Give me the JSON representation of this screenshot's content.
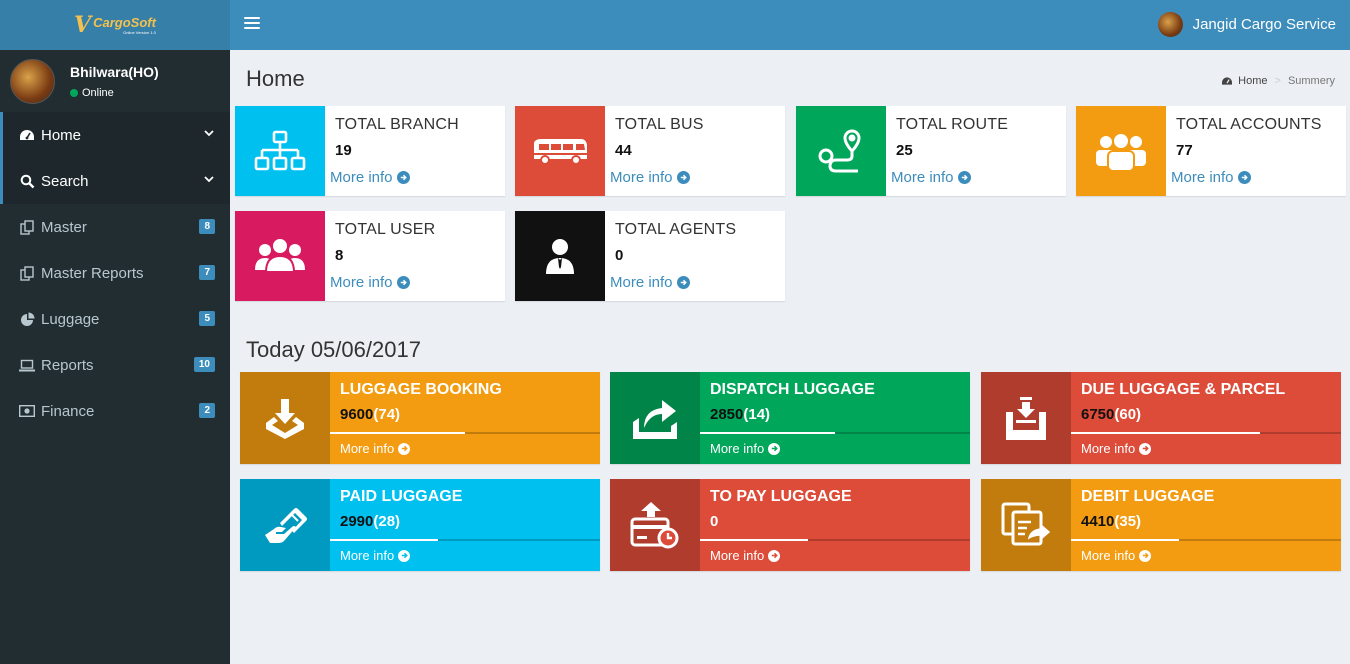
{
  "brand": {
    "name": "CargoSoft",
    "tagline": "Online Version 1.0"
  },
  "header": {
    "company": "Jangid Cargo Service"
  },
  "user": {
    "name": "Bhilwara(HO)",
    "status": "Online"
  },
  "menu": [
    {
      "label": "Home",
      "icon": "dashboard-icon",
      "active": true,
      "badge": ""
    },
    {
      "label": "Search",
      "icon": "search-icon",
      "active": true,
      "badge": ""
    },
    {
      "label": "Master",
      "icon": "copy-icon",
      "active": false,
      "badge": "8"
    },
    {
      "label": "Master Reports",
      "icon": "copy-icon",
      "active": false,
      "badge": "7"
    },
    {
      "label": "Luggage",
      "icon": "pie-chart-icon",
      "active": false,
      "badge": "5"
    },
    {
      "label": "Reports",
      "icon": "laptop-icon",
      "active": false,
      "badge": "10"
    },
    {
      "label": "Finance",
      "icon": "money-icon",
      "active": false,
      "badge": "2"
    }
  ],
  "page": {
    "title": "Home",
    "breadcrumb_home": "Home",
    "breadcrumb_current": "Summery"
  },
  "info_boxes": [
    {
      "label": "TOTAL BRANCH",
      "value": "19",
      "more": "More info",
      "color": "#00c0ef",
      "icon": "sitemap-icon"
    },
    {
      "label": "TOTAL BUS",
      "value": "44",
      "more": "More info",
      "color": "#dd4b39",
      "icon": "bus-icon"
    },
    {
      "label": "TOTAL ROUTE",
      "value": "25",
      "more": "More info",
      "color": "#00a65a",
      "icon": "route-icon"
    },
    {
      "label": "TOTAL ACCOUNTS",
      "value": "77",
      "more": "More info",
      "color": "#f39c12",
      "icon": "users-icon"
    },
    {
      "label": "TOTAL USER",
      "value": "8",
      "more": "More info",
      "color": "#d81b60",
      "icon": "group-icon"
    },
    {
      "label": "TOTAL AGENTS",
      "value": "0",
      "more": "More info",
      "color": "#111111",
      "icon": "agent-icon"
    }
  ],
  "today": {
    "label": "Today 05/06/2017"
  },
  "stat_boxes": [
    {
      "title": "LUGGAGE BOOKING",
      "amount": "9600",
      "count": "(74)",
      "progress": 0.5,
      "more": "More info",
      "color": "#f39c12",
      "icon": "download-tray-icon"
    },
    {
      "title": "DISPATCH LUGGAGE",
      "amount": "2850",
      "count": "(14)",
      "progress": 0.5,
      "more": "More info",
      "color": "#00a65a",
      "icon": "share-box-icon"
    },
    {
      "title": "DUE LUGGAGE & PARCEL",
      "amount": "6750",
      "count": "(60)",
      "progress": 0.7,
      "more": "More info",
      "color": "#dd4b39",
      "icon": "inbox-download-icon"
    },
    {
      "title": "PAID LUGGAGE",
      "amount": "2990",
      "count": "(28)",
      "progress": 0.4,
      "more": "More info",
      "color": "#00c0ef",
      "icon": "hand-card-icon"
    },
    {
      "title": "TO PAY LUGGAGE",
      "amount": "0",
      "count": "",
      "progress": 0.4,
      "more": "More info",
      "color": "#dd4b39",
      "icon": "pay-clock-icon"
    },
    {
      "title": "DEBIT LUGGAGE",
      "amount": "4410",
      "count": "(35)",
      "progress": 0.4,
      "more": "More info",
      "color": "#f39c12",
      "icon": "copy-share-icon"
    }
  ]
}
